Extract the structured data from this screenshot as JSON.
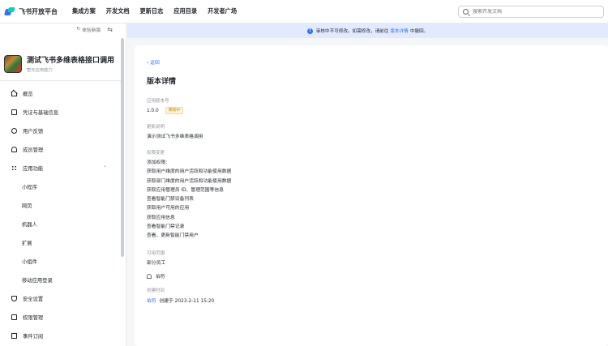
{
  "topbar": {
    "logo_text": "飞书开放平台",
    "nav": [
      "集成方案",
      "开发文档",
      "更新日志",
      "应用目录",
      "开发者广场"
    ],
    "search_placeholder": "搜索开发文档"
  },
  "sidebar": {
    "refresh_label": "体验新版",
    "app_name": "测试飞书多维表格接口调用",
    "app_subtitle": "暂无应用能力",
    "menu": [
      {
        "label": "概览",
        "icon": "home-icon"
      },
      {
        "label": "凭证与基础信息",
        "icon": "credential-icon"
      },
      {
        "label": "用户反馈",
        "icon": "feedback-icon"
      },
      {
        "label": "成员管理",
        "icon": "member-icon"
      },
      {
        "label": "应用功能",
        "icon": "app-features-icon",
        "expanded": true
      },
      {
        "label": "小程序",
        "sub": true
      },
      {
        "label": "网页",
        "sub": true
      },
      {
        "label": "机器人",
        "sub": true
      },
      {
        "label": "扩展",
        "sub": true
      },
      {
        "label": "小组件",
        "sub": true
      },
      {
        "label": "移动应用登录",
        "sub": true
      },
      {
        "label": "安全设置",
        "icon": "shield-icon"
      },
      {
        "label": "权限管理",
        "icon": "permission-icon"
      },
      {
        "label": "事件订阅",
        "icon": "event-icon"
      }
    ]
  },
  "banner": {
    "text_before": "审核中不可修改。如需修改，请前往",
    "link": "版本详情",
    "text_after": "中撤回。"
  },
  "content": {
    "back_label": "返回",
    "title": "版本详情",
    "version_label": "应用版本号",
    "version_value": "1.0.0",
    "status_badge": "审核中",
    "desc_label": "更新说明",
    "desc_value": "演示测试飞书多维表格调用",
    "perm_label": "权限变更",
    "perm_lines": [
      "添加权限:",
      "获取用户维度的用户活跃和功能使用数据",
      "获取部门维度的用户活跃和功能使用数据",
      "获取应用管理员 ID、管理范围等信息",
      "查看智能门禁设备列表",
      "获取用户可用的应用",
      "获取应用信息",
      "查看智能门禁记录",
      "查看、更新智能门禁用户"
    ],
    "scope_label": "可用范围",
    "scope_value": "部分员工",
    "scope_user": "伯符",
    "created_label": "创建时间",
    "created_by": "伯符",
    "created_value": "创建于 2023-2-11 15:20"
  },
  "colors": {
    "accent": "#3370ff",
    "banner_bg": "#e1eaff",
    "badge_text": "#c78a00"
  }
}
